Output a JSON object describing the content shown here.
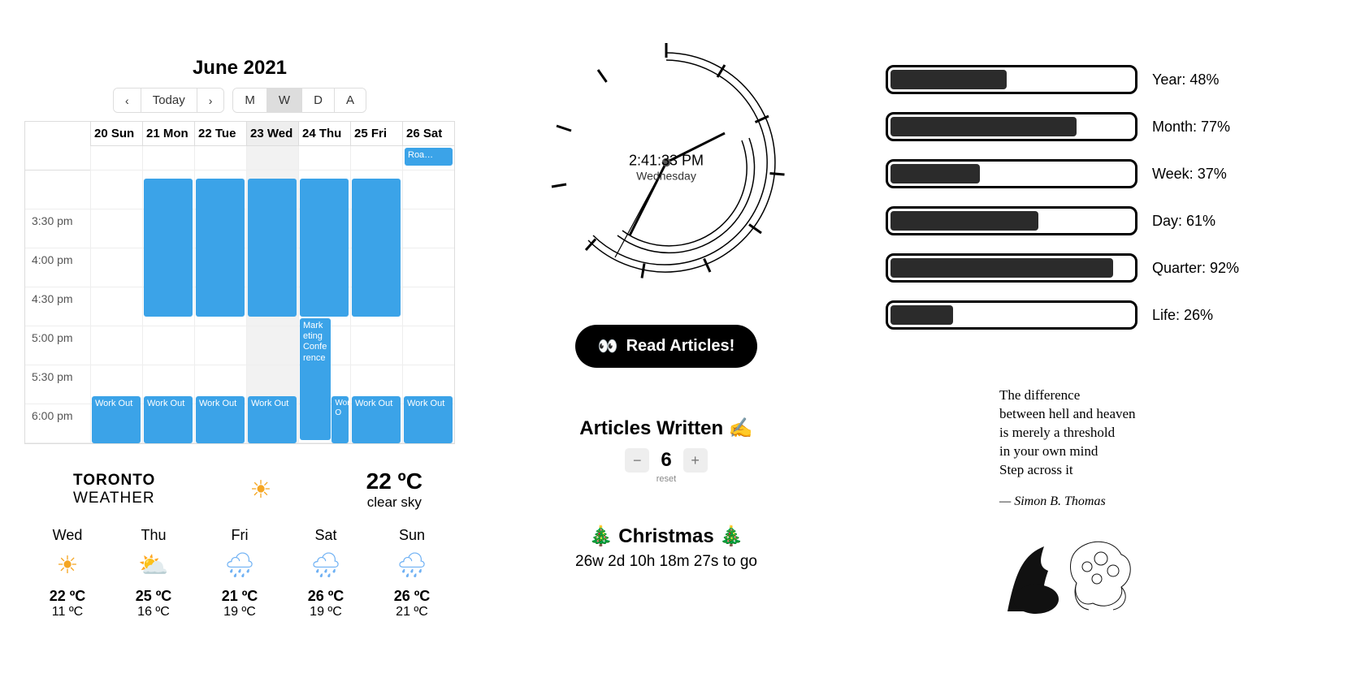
{
  "calendar": {
    "title": "June 2021",
    "nav": {
      "prev": "‹",
      "today": "Today",
      "next": "›"
    },
    "views": {
      "month": "M",
      "week": "W",
      "day": "D",
      "agenda": "A"
    },
    "active_view": "W",
    "days": [
      {
        "label": "20 Sun",
        "today": false
      },
      {
        "label": "21 Mon",
        "today": false
      },
      {
        "label": "22 Tue",
        "today": false
      },
      {
        "label": "23 Wed",
        "today": true
      },
      {
        "label": "24 Thu",
        "today": false
      },
      {
        "label": "25 Fri",
        "today": false
      },
      {
        "label": "26 Sat",
        "today": false
      }
    ],
    "times": [
      "3:30 pm",
      "4:00 pm",
      "4:30 pm",
      "5:00 pm",
      "5:30 pm",
      "6:00 pm"
    ],
    "events": {
      "roa": "Roa…",
      "marketing": "Marketing Conference",
      "workout": "Work Out",
      "workout_short": "Work O"
    }
  },
  "weather": {
    "city": "TORONTO",
    "city_sub": "WEATHER",
    "current_temp": "22 ºC",
    "current_desc": "clear sky",
    "days": [
      {
        "label": "Wed",
        "icon": "sun",
        "hi": "22 ºC",
        "lo": "11 ºC"
      },
      {
        "label": "Thu",
        "icon": "partly",
        "hi": "25 ºC",
        "lo": "16 ºC"
      },
      {
        "label": "Fri",
        "icon": "rain",
        "hi": "21 ºC",
        "lo": "19 ºC"
      },
      {
        "label": "Sat",
        "icon": "rain",
        "hi": "26 ºC",
        "lo": "19 ºC"
      },
      {
        "label": "Sun",
        "icon": "rain",
        "hi": "26 ºC",
        "lo": "21 ºC"
      }
    ]
  },
  "clock": {
    "time": "2:41:33 PM",
    "day": "Wednesday"
  },
  "read_button": {
    "icon": "👀",
    "label": "Read Articles!"
  },
  "counter": {
    "title": "Articles Written ✍️",
    "value": "6",
    "minus": "−",
    "plus": "+",
    "reset": "reset"
  },
  "countdown": {
    "title": "🎄 Christmas 🎄",
    "remaining": "26w 2d 10h 18m 27s to go"
  },
  "progress": [
    {
      "label": "Year: 48%",
      "value": 48
    },
    {
      "label": "Month: 77%",
      "value": 77
    },
    {
      "label": "Week: 37%",
      "value": 37
    },
    {
      "label": "Day: 61%",
      "value": 61
    },
    {
      "label": "Quarter: 92%",
      "value": 92
    },
    {
      "label": "Life: 26%",
      "value": 26
    }
  ],
  "quote": {
    "line1": "The difference",
    "line2": "between hell and heaven",
    "line3": "is merely a threshold",
    "line4": "in your own mind",
    "line5": "Step across it",
    "author": "— Simon B. Thomas"
  }
}
